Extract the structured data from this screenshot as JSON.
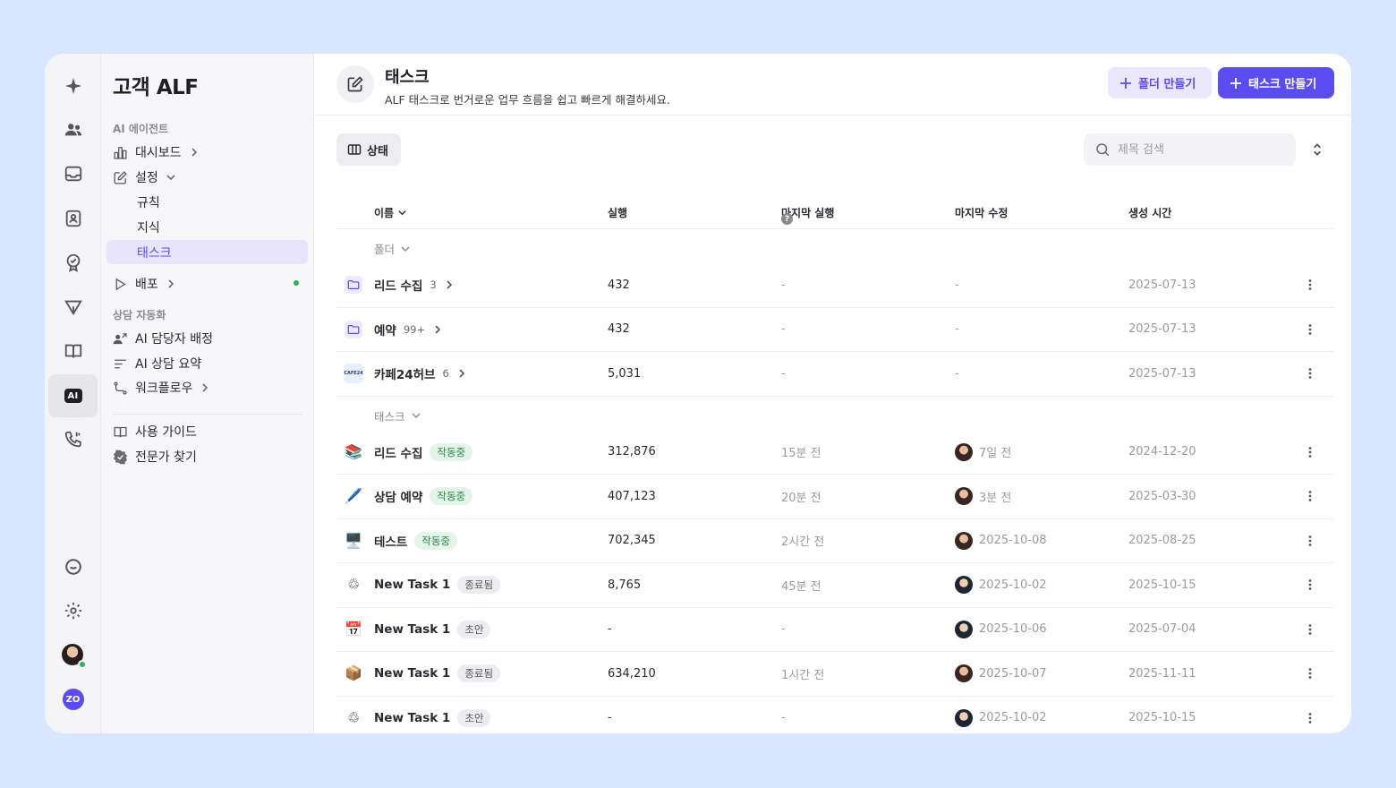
{
  "sidebar": {
    "title": "고객 ALF",
    "section_ai": "AI 에이전트",
    "dashboard": "대시보드",
    "settings": "설정",
    "rules": "규칙",
    "knowledge": "지식",
    "tasks": "태스크",
    "deploy": "배포",
    "section_automation": "상담 자동화",
    "ai_assign": "AI 담당자 배정",
    "ai_summary": "AI 상담 요약",
    "workflow": "워크플로우",
    "guide": "사용 가이드",
    "expert": "전문가 찾기"
  },
  "rail": {
    "ai_label": "AI",
    "zo_label": "ZO"
  },
  "header": {
    "title": "태스크",
    "subtitle": "ALF 태스크로 번거로운 업무 흐름을 쉽고 빠르게 해결하세요.",
    "folder_button": "폴더 만들기",
    "task_button": "태스크 만들기"
  },
  "toolbar": {
    "status_label": "상태",
    "search_placeholder": "제목 검색"
  },
  "table": {
    "columns": {
      "name": "이름",
      "runs": "실행",
      "last_run": "마지막 실행",
      "last_modified": "마지막 수정",
      "created": "생성 시간"
    },
    "help_glyph": "?",
    "folder_group": "폴더",
    "task_group": "태스크",
    "folders": [
      {
        "name": "리드 수집",
        "count": "3",
        "runs": "432",
        "last_run": "-",
        "last_modified": "-",
        "created": "2025-07-13",
        "icon": "folder-icon"
      },
      {
        "name": "예약",
        "count": "99+",
        "runs": "432",
        "last_run": "-",
        "last_modified": "-",
        "created": "2025-07-13",
        "icon": "folder-icon"
      },
      {
        "name": "카페24허브",
        "count": "6",
        "runs": "5,031",
        "last_run": "-",
        "last_modified": "-",
        "created": "2025-07-13",
        "icon": "cafe24-icon",
        "icon_text": "CAFE24"
      }
    ],
    "tasks": [
      {
        "name": "리드 수집",
        "status": "작동중",
        "runs": "312,876",
        "last_run": "15분 전",
        "last_modified": "7일 전",
        "created": "2024-12-20",
        "icon": "books-icon",
        "glyph": "📚"
      },
      {
        "name": "상담 예약",
        "status": "작동중",
        "runs": "407,123",
        "last_run": "20분 전",
        "last_modified": "3분 전",
        "created": "2025-03-30",
        "icon": "pen-icon",
        "glyph": "🖊️"
      },
      {
        "name": "테스트",
        "status": "작동중",
        "runs": "702,345",
        "last_run": "2시간 전",
        "last_modified": "2025-10-08",
        "created": "2025-08-25",
        "icon": "monitor-icon",
        "glyph": "🖥️"
      },
      {
        "name": "New Task 1",
        "status": "종료됨",
        "runs": "8,765",
        "last_run": "45분 전",
        "last_modified": "2025-10-02",
        "created": "2025-10-15",
        "icon": "cycle-icon",
        "glyph": "♲"
      },
      {
        "name": "New Task 1",
        "status": "초안",
        "runs": "-",
        "last_run": "-",
        "last_modified": "2025-10-06",
        "created": "2025-07-04",
        "icon": "calendar-icon",
        "glyph": "📅"
      },
      {
        "name": "New Task 1",
        "status": "종료됨",
        "runs": "634,210",
        "last_run": "1시간 전",
        "last_modified": "2025-10-07",
        "created": "2025-11-11",
        "icon": "package-icon",
        "glyph": "📦"
      },
      {
        "name": "New Task 1",
        "status": "초안",
        "runs": "-",
        "last_run": "-",
        "last_modified": "2025-10-02",
        "created": "2025-10-15",
        "icon": "cycle-icon",
        "glyph": "♲"
      }
    ]
  },
  "colors": {
    "accent": "#5b4cf0",
    "accent_soft": "#ebe8fd",
    "running": "#2b8a4a",
    "online": "#2fb35a",
    "backdrop": "#d9e6ff"
  }
}
